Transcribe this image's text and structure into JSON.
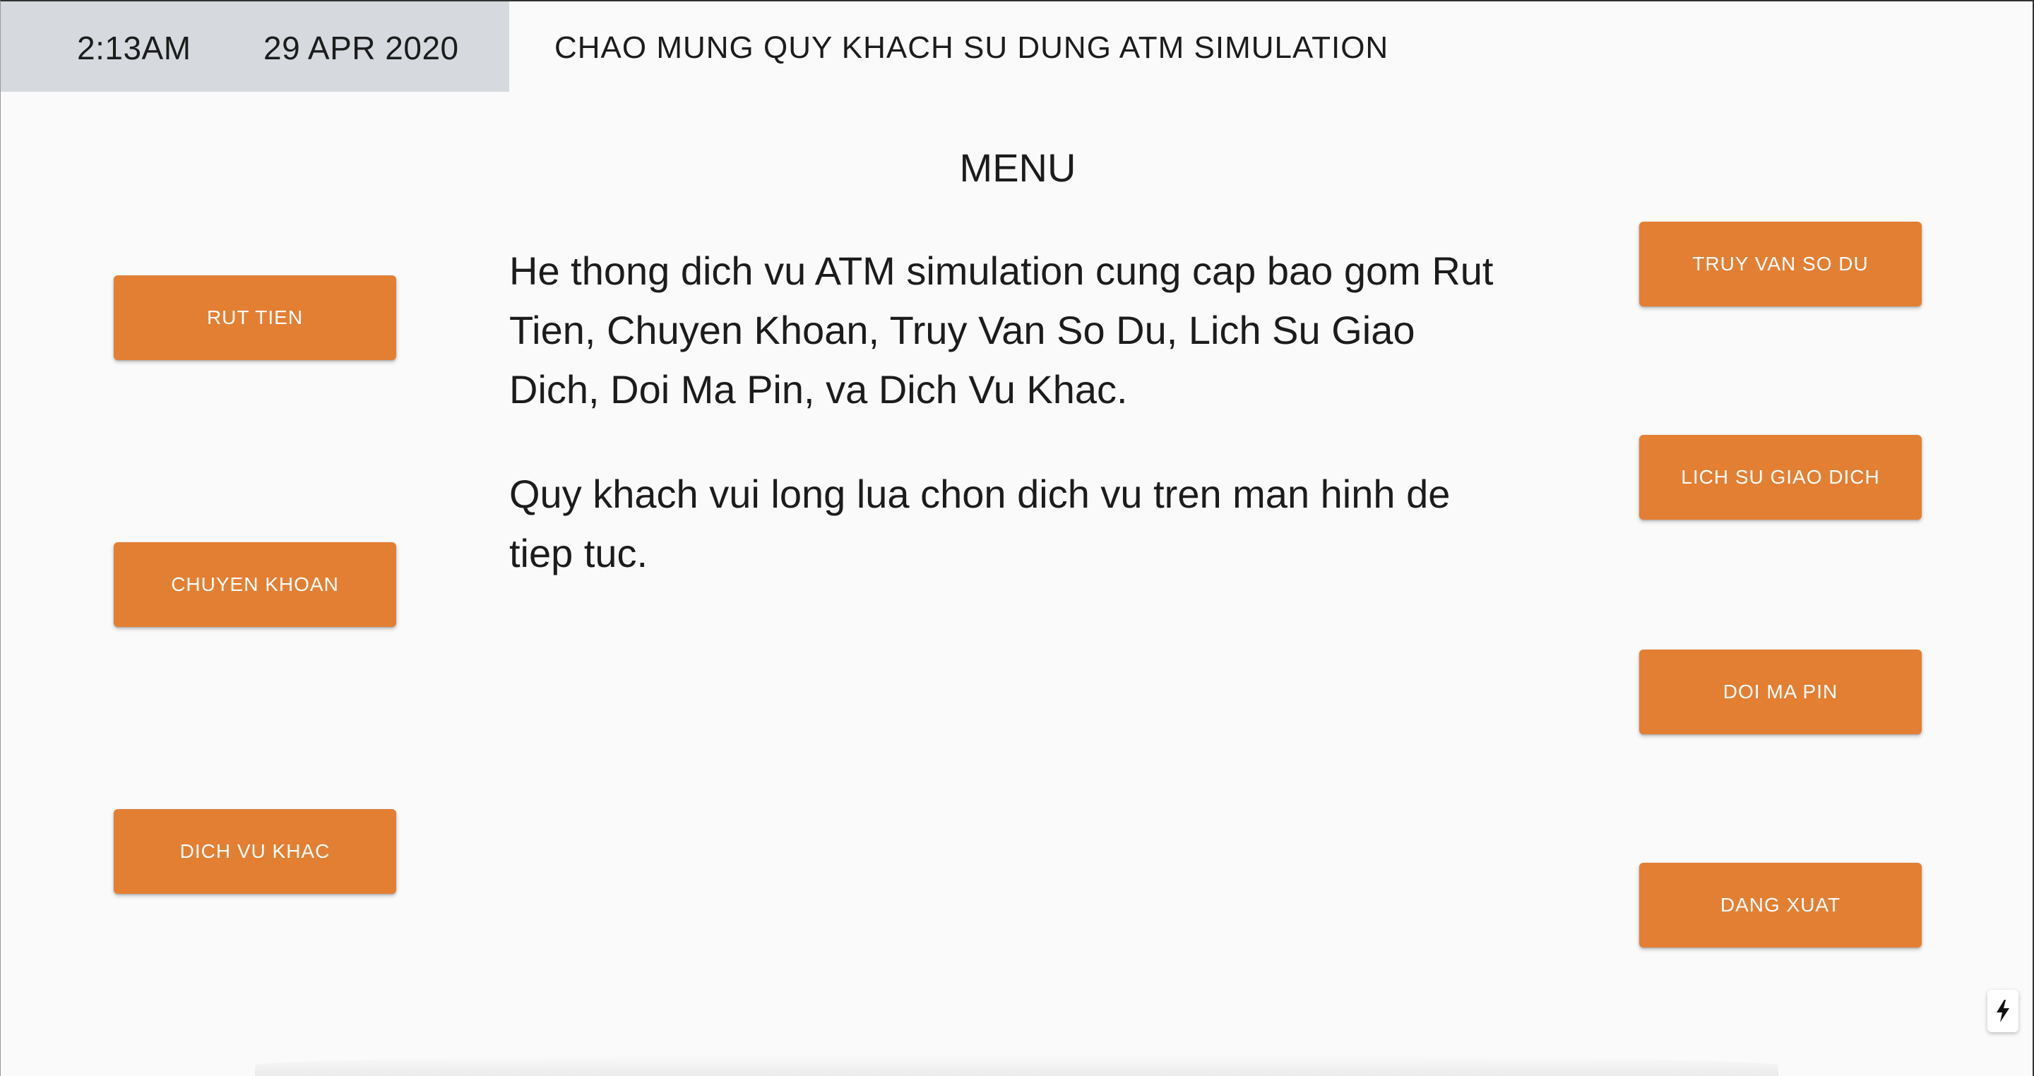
{
  "header": {
    "time": "2:13AM",
    "date": "29 APR 2020",
    "welcome": "CHAO MUNG QUY KHACH SU DUNG ATM SIMULATION"
  },
  "main": {
    "title": "MENU",
    "description": "He thong dich vu ATM simulation cung cap bao gom Rut Tien, Chuyen Khoan, Truy Van So Du, Lich Su Giao Dich, Doi Ma Pin, va Dich Vu Khac.",
    "instruction": "Quy khach vui long lua chon dich vu tren man hinh de tiep tuc."
  },
  "left_buttons": {
    "withdraw": "RUT TIEN",
    "transfer": "CHUYEN KHOAN",
    "other_services": "DICH VU KHAC"
  },
  "right_buttons": {
    "balance_inquiry": "TRUY VAN SO DU",
    "transaction_history": "LICH SU GIAO DICH",
    "change_pin": "DOI MA PIN",
    "logout": "DANG XUAT"
  },
  "icons": {
    "corner_action": "lightning-bolt-icon"
  },
  "colors": {
    "button": "#e37f33",
    "button_text": "#ffffff",
    "header_bg": "#d6dadf",
    "page_bg": "#fafafa"
  }
}
